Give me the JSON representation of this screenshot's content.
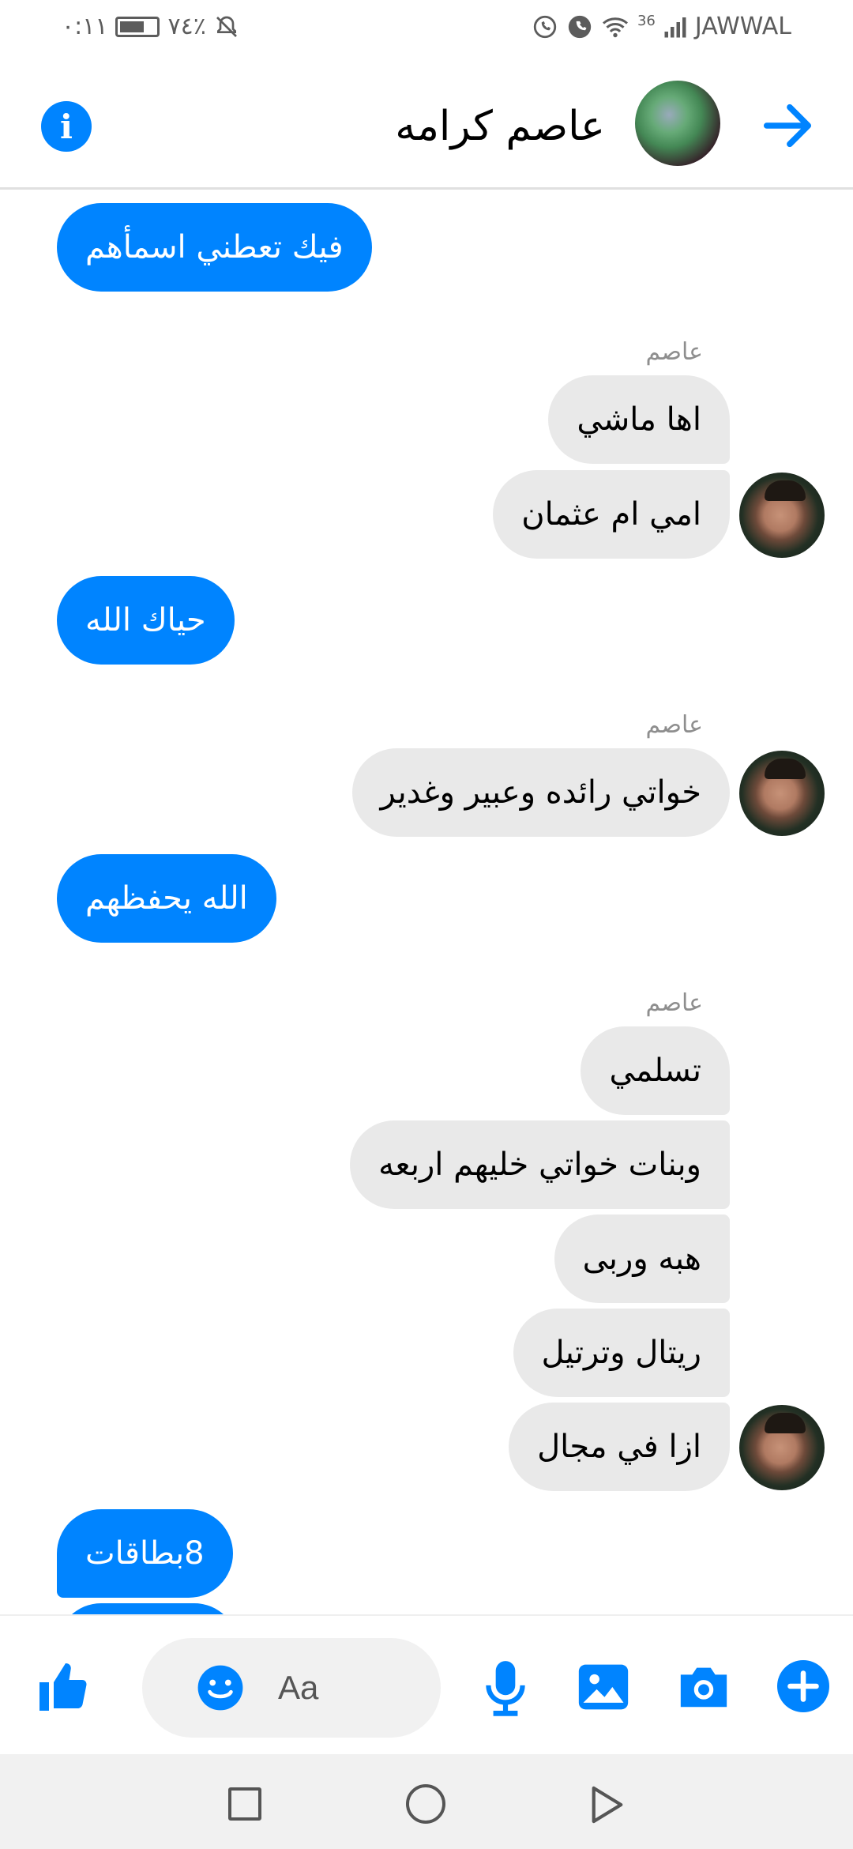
{
  "status_bar": {
    "time": "٠:١١",
    "battery": "٧٤٪",
    "network": "36",
    "carrier": "JAWWAL"
  },
  "header": {
    "contact_name": "عاصم كرامه",
    "icons": {
      "info": "info-icon",
      "back": "arrow-right-icon"
    }
  },
  "conversation": {
    "sender_label": "عاصم",
    "messages": [
      {
        "from": "me",
        "text": "فيك تعطني اسمأهم"
      },
      {
        "from": "them",
        "text": "اها ماشي"
      },
      {
        "from": "them",
        "text": "امي ام عثمان"
      },
      {
        "from": "me",
        "text": "حياك الله"
      },
      {
        "from": "them",
        "text": "خواتي رائده وعبير وغدير"
      },
      {
        "from": "me",
        "text": "الله يحفظهم"
      },
      {
        "from": "them",
        "text": "تسلمي"
      },
      {
        "from": "them",
        "text": "وبنات خواتي خليهم اربعه"
      },
      {
        "from": "them",
        "text": "هبه وربى"
      },
      {
        "from": "them",
        "text": "ريتال وترتيل"
      },
      {
        "from": "them",
        "text": "ازا في مجال"
      },
      {
        "from": "me",
        "text": "8بطاقات"
      }
    ]
  },
  "composer": {
    "placeholder": "Aa",
    "icons": [
      "thumbs-up-icon",
      "emoji-icon",
      "microphone-icon",
      "image-icon",
      "camera-icon",
      "plus-icon"
    ]
  },
  "theme": {
    "accent": "#0084ff",
    "incoming_bubble": "#e9e9e9",
    "sender_label": "#8e8e8e"
  }
}
